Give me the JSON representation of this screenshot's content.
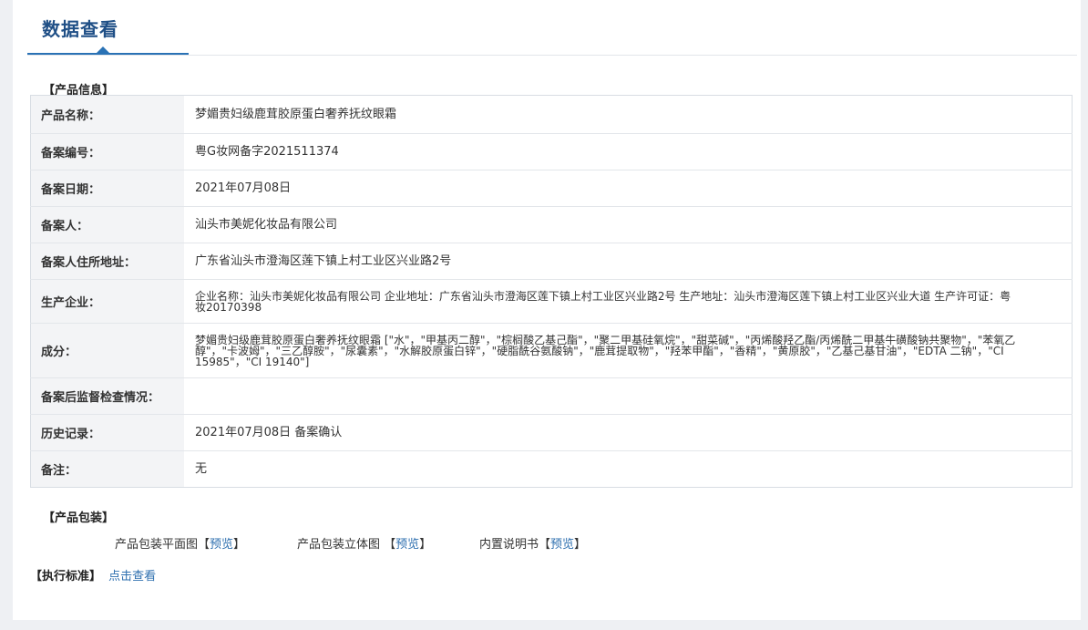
{
  "header": {
    "title": "数据查看"
  },
  "product_info": {
    "section_title": "【产品信息】",
    "rows": [
      {
        "label": "产品名称：",
        "value": "梦媚贵妇级鹿茸胶原蛋白奢养抚纹眼霜"
      },
      {
        "label": "备案编号：",
        "value": "粤G妆网备字2021511374"
      },
      {
        "label": "备案日期：",
        "value": "2021年07月08日"
      },
      {
        "label": "备案人：",
        "value": "汕头市美妮化妆品有限公司"
      },
      {
        "label": "备案人住所地址：",
        "value": "广东省汕头市澄海区莲下镇上村工业区兴业路2号"
      },
      {
        "label": "生产企业：",
        "value": "企业名称：汕头市美妮化妆品有限公司 企业地址：广东省汕头市澄海区莲下镇上村工业区兴业路2号 生产地址：汕头市澄海区莲下镇上村工业区兴业大道 生产许可证：粤妆20170398"
      },
      {
        "label": "成分：",
        "value": "梦媚贵妇级鹿茸胶原蛋白奢养抚纹眼霜 [\"水\"，\"甲基丙二醇\"，\"棕榈酸乙基己酯\"，\"聚二甲基硅氧烷\"，\"甜菜碱\"，\"丙烯酸羟乙酯/丙烯酰二甲基牛磺酸钠共聚物\"，\"苯氧乙醇\"，\"卡波姆\"，\"三乙醇胺\"，\"尿囊素\"，\"水解胶原蛋白锌\"，\"硬脂酰谷氨酸钠\"，\"鹿茸提取物\"，\"羟苯甲酯\"，\"香精\"，\"黄原胶\"，\"乙基己基甘油\"，\"EDTA 二钠\"，\"CI 15985\"，\"CI 19140\"]"
      },
      {
        "label": "备案后监督检查情况：",
        "value": ""
      },
      {
        "label": "历史记录：",
        "value": "2021年07月08日 备案确认"
      },
      {
        "label": "备注：",
        "value": "无"
      }
    ]
  },
  "packaging": {
    "section_title": "【产品包装】",
    "items": [
      {
        "label": "产品包装平面图",
        "open": "【",
        "link": "预览",
        "close": "】"
      },
      {
        "label": "产品包装立体图",
        "open": "【",
        "link": "预览",
        "close": "】"
      },
      {
        "label": "内置说明书",
        "open": "【",
        "link": "预览",
        "close": "】"
      }
    ]
  },
  "standard": {
    "section_title": "【执行标准】",
    "link": "点击查看"
  },
  "colors": {
    "accent": "#2a72b5",
    "title": "#1f4f86",
    "link": "#2e6faf",
    "label_bg": "#f3f4f6"
  }
}
